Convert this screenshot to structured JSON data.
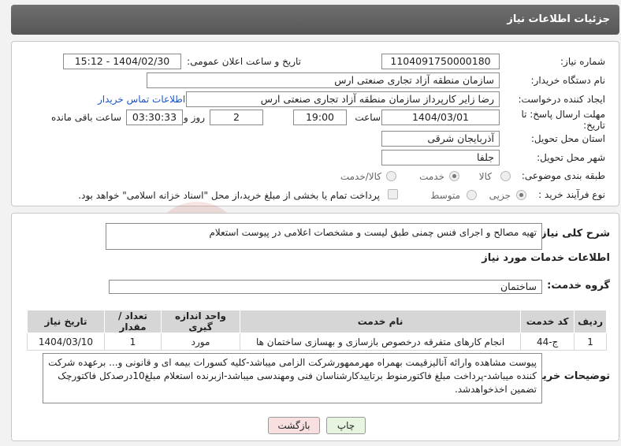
{
  "header": {
    "title": "جزئیات اطلاعات نیاز"
  },
  "form": {
    "need_number_label": "شماره نیاز:",
    "need_number": "1104091750000180",
    "announce_label": "تاریخ و ساعت اعلان عمومی:",
    "announce_value": "1404/02/30 - 15:12",
    "buyer_org_label": "نام دستگاه خریدار:",
    "buyer_org": "سازمان منطقه آزاد تجاری صنعتی ارس",
    "requester_label": "ایجاد کننده درخواست:",
    "requester": "رضا زایر کارپرداز سازمان منطقه آزاد تجاری صنعتی ارس",
    "contact_link": "اطلاعات تماس خریدار",
    "deadline_label_1": "مهلت ارسال پاسخ: تا",
    "deadline_label_2": "تاریخ:",
    "deadline_date": "1404/03/01",
    "time_label": "ساعت",
    "deadline_time": "19:00",
    "days_value": "2",
    "days_label": "روز و",
    "remaining_value": "03:30:33",
    "remaining_label": "ساعت باقی مانده",
    "province_label": "استان محل تحویل:",
    "province": "آذربایجان شرقی",
    "city_label": "شهر محل تحویل:",
    "city": "جلفا",
    "category_label": "طبقه بندی موضوعی:",
    "category_options": [
      "کالا",
      "خدمت",
      "کالا/خدمت"
    ],
    "category_selected": "خدمت",
    "process_label": "نوع فرآیند خرید :",
    "process_options": [
      "جزیی",
      "متوسط"
    ],
    "process_selected": "جزیی",
    "payment_note": "پرداخت تمام یا بخشی از مبلغ خرید،از محل \"اسناد خزانه اسلامی\" خواهد بود."
  },
  "description": {
    "label": "شرح کلی نیاز:",
    "text": "تهیه مصالح و اجرای فنس چمنی طبق لیست و مشخصات اعلامی در پیوست استعلام"
  },
  "services": {
    "section_title": "اطلاعات خدمات مورد نیاز",
    "group_label": "گروه خدمت:",
    "group_value": "ساختمان",
    "columns": [
      "ردیف",
      "کد خدمت",
      "نام خدمت",
      "واحد اندازه گیری",
      "تعداد / مقدار",
      "تاریخ نیاز"
    ],
    "rows": [
      [
        "1",
        "ج-44",
        "انجام کارهای متفرقه درخصوص بازسازی و بهسازی ساختمان ها",
        "مورد",
        "1",
        "1404/03/10"
      ]
    ]
  },
  "buyer_notes": {
    "label": "توضیحات خریدار:",
    "text": "پیوست مشاهده وارائه آنالیزقیمت بهمراه مهرممهورشرکت الزامی میباشد-کلیه کسورات بیمه ای و قانونی و... برعهده شرکت کننده میباشد-پرداخت مبلغ فاکتورمنوط برتاییدکارشناسان فنی ومهندسی میباشد-ازبرنده استعلام مبلغ10درصدکل فاکتورچک تضمین اخذخواهدشد."
  },
  "buttons": {
    "print": "چاپ",
    "back": "بازگشت"
  },
  "watermark": {
    "text": "AriaTender.neT"
  },
  "colors": {
    "header": "#5f5f5f",
    "link": "#1a56c8",
    "print_btn": "#e6f4e0",
    "back_btn": "#f8e0e0"
  }
}
